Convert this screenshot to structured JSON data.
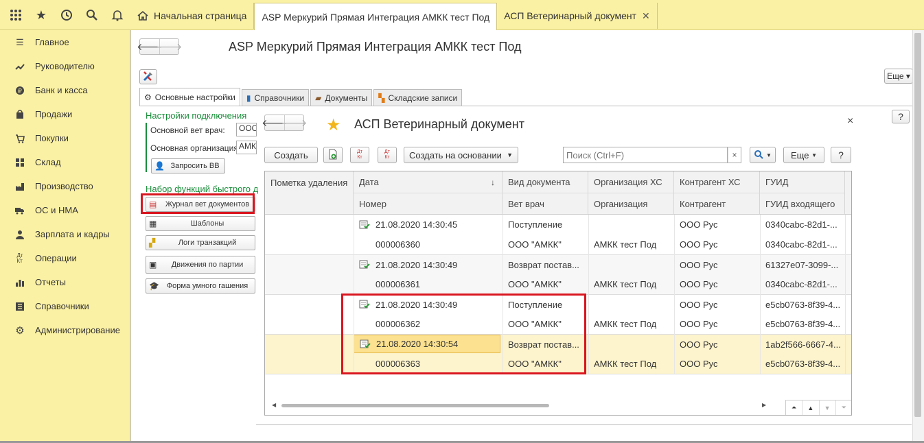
{
  "topbar": {
    "icons": [
      "apps-grid-icon",
      "star-icon",
      "history-icon",
      "search-icon",
      "bell-icon"
    ],
    "tabs": [
      {
        "label": "Начальная страница",
        "icon": "home-icon"
      },
      {
        "label": "ASP Меркурий Прямая Интеграция АМКК тест Под",
        "active": true
      },
      {
        "label": "АСП Ветеринарный документ"
      }
    ]
  },
  "sidebar": {
    "items": [
      {
        "label": "Главное",
        "icon": "menu-icon"
      },
      {
        "label": "Руководителю",
        "icon": "trend-icon"
      },
      {
        "label": "Банк и касса",
        "icon": "coin-icon"
      },
      {
        "label": "Продажи",
        "icon": "cart-icon"
      },
      {
        "label": "Покупки",
        "icon": "basket-icon"
      },
      {
        "label": "Склад",
        "icon": "warehouse-icon"
      },
      {
        "label": "Производство",
        "icon": "production-icon"
      },
      {
        "label": "ОС и НМА",
        "icon": "truck-icon"
      },
      {
        "label": "Зарплата и кадры",
        "icon": "person-icon"
      },
      {
        "label": "Операции",
        "icon": "dt-kt-icon"
      },
      {
        "label": "Отчеты",
        "icon": "report-icon"
      },
      {
        "label": "Справочники",
        "icon": "book-icon"
      },
      {
        "label": "Администрирование",
        "icon": "gear-icon"
      }
    ]
  },
  "main": {
    "title": "ASP Меркурий Прямая Интеграция АМКК тест Под",
    "more_label": "Еще",
    "help_label": "?",
    "subtabs": [
      {
        "label": "Основные настройки",
        "icon": "gear-icon",
        "active": true
      },
      {
        "label": "Справочники",
        "icon": "book-icon"
      },
      {
        "label": "Документы",
        "icon": "briefcase-icon"
      },
      {
        "label": "Складские записи",
        "icon": "blocks-icon"
      }
    ],
    "connection": {
      "title": "Настройки подключения",
      "vet_label": "Основной вет врач:",
      "vet_value": "ООО",
      "org_label": "Основная организация:",
      "org_value": "АМКК",
      "request_btn": "Запросить ВВ"
    },
    "quick": {
      "title": "Набор функций быстрого д",
      "buttons": [
        {
          "label": "Журнал вет документов",
          "icon": "journal-icon"
        },
        {
          "label": "Шаблоны",
          "icon": "templates-icon"
        },
        {
          "label": "Логи транзакций",
          "icon": "logs-icon"
        },
        {
          "label": "Движения по партии",
          "icon": "movements-icon"
        },
        {
          "label": "Форма умного гашения",
          "icon": "graduation-icon"
        }
      ]
    }
  },
  "form": {
    "title": "АСП Ветеринарный документ",
    "close": "×",
    "toolbar": {
      "create": "Создать",
      "create_basis": "Создать на основании",
      "search_placeholder": "Поиск (Ctrl+F)",
      "search_clear": "×",
      "more": "Еще",
      "help": "?",
      "dt": "Дт",
      "kt": "Кт"
    },
    "columns": {
      "row1": [
        "Пометка удаления",
        "Дата",
        "Вид документа",
        "Организация ХС",
        "Контрагент ХС",
        "ГУИД"
      ],
      "row2": [
        "Номер",
        "Вет врач",
        "Организация",
        "Контрагент",
        "ГУИД входящего"
      ]
    },
    "rows": [
      {
        "date": "21.08.2020 14:30:45",
        "number": "000006360",
        "doc_type": "Поступление",
        "vet": "ООО \"АМКК\"",
        "org_hs": "",
        "org": "АМКК тест Под",
        "contr_hs": "ООО Рус",
        "contr": "ООО Рус",
        "guid": "0340cabc-82d1-...",
        "guid_in": "0340cabc-82d1-..."
      },
      {
        "date": "21.08.2020 14:30:49",
        "number": "000006361",
        "doc_type": "Возврат постав...",
        "vet": "ООО \"АМКК\"",
        "org_hs": "",
        "org": "АМКК тест Под",
        "contr_hs": "ООО Рус",
        "contr": "ООО Рус",
        "guid": "61327e07-3099-...",
        "guid_in": "0340cabc-82d1-..."
      },
      {
        "date": "21.08.2020 14:30:49",
        "number": "000006362",
        "doc_type": "Поступление",
        "vet": "ООО \"АМКК\"",
        "org_hs": "",
        "org": "АМКК тест Под",
        "contr_hs": "ООО Рус",
        "contr": "ООО Рус",
        "guid": "e5cb0763-8f39-4...",
        "guid_in": "e5cb0763-8f39-4..."
      },
      {
        "date": "21.08.2020 14:30:54",
        "number": "000006363",
        "doc_type": "Возврат постав...",
        "vet": "ООО \"АМКК\"",
        "org_hs": "",
        "org": "АМКК тест Под",
        "contr_hs": "ООО Рус",
        "contr": "ООО Рус",
        "guid": "1ab2f566-6667-4...",
        "guid_in": "e5cb0763-8f39-4...",
        "selected": true
      }
    ]
  },
  "colors": {
    "sidebar_bg": "#fbf1a5",
    "section_green": "#1a8c3a",
    "highlight_red": "#d9161f",
    "selected_row": "#fdf3cc",
    "selected_cell": "#fbe190"
  }
}
